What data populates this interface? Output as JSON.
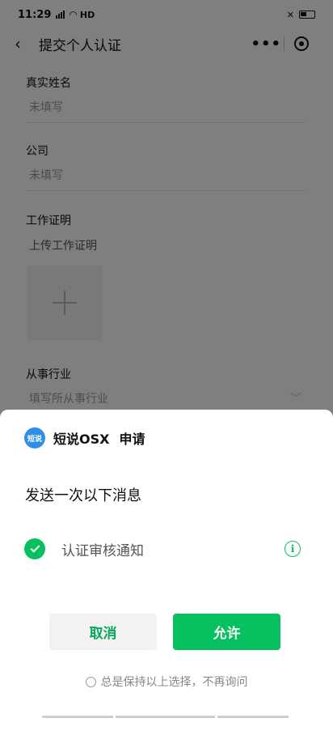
{
  "status_bar": {
    "time": "11:29",
    "network": "HD"
  },
  "nav": {
    "title": "提交个人认证"
  },
  "form": {
    "name": {
      "label": "真实姓名",
      "placeholder": "未填写"
    },
    "company": {
      "label": "公司",
      "placeholder": "未填写"
    },
    "work_proof": {
      "label": "工作证明",
      "hint": "上传工作证明"
    },
    "industry": {
      "label": "从事行业",
      "placeholder": "填写所从事行业"
    }
  },
  "sheet": {
    "logo_text": "短说",
    "app_name": "短说OSX",
    "action": "申请",
    "subtitle": "发送一次以下消息",
    "permission": {
      "label": "认证审核通知",
      "checked": true
    },
    "cancel_label": "取消",
    "allow_label": "允许",
    "keep_choice_label": "总是保持以上选择，不再询问"
  },
  "colors": {
    "accent": "#07c160",
    "logo": "#2f8fe8"
  }
}
